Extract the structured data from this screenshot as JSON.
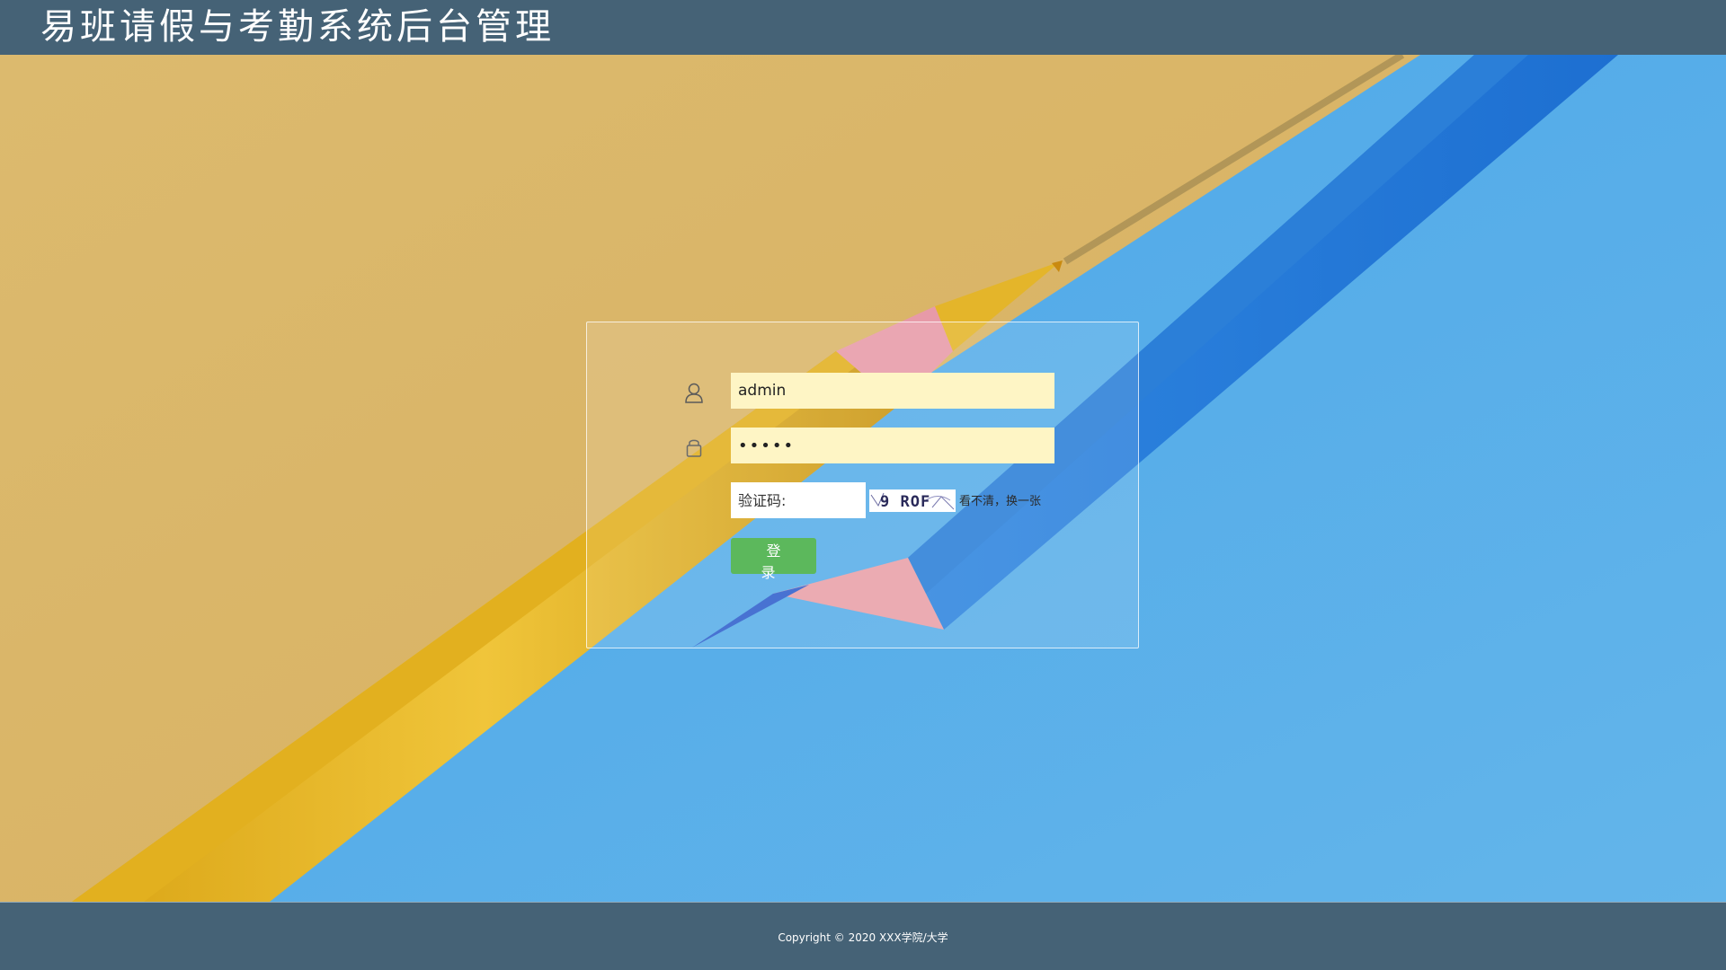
{
  "header": {
    "title": "易班请假与考勤系统后台管理"
  },
  "login": {
    "username_value": "admin",
    "password_value": "•••••",
    "captcha_placeholder": "验证码:",
    "captcha_text": "9 ROF",
    "captcha_refresh_label": "看不清，换一张",
    "login_button_label": "登 录",
    "user_icon": "user-icon",
    "lock_icon": "lock-icon"
  },
  "footer": {
    "copyright": "Copyright © 2020 XXX学院/大学"
  },
  "colors": {
    "header_bg": "#456276",
    "input_bg": "#fef5c5",
    "button_bg": "#5cb85c",
    "bg_yellow": "#dcb969",
    "bg_blue": "#5ab0ea"
  }
}
